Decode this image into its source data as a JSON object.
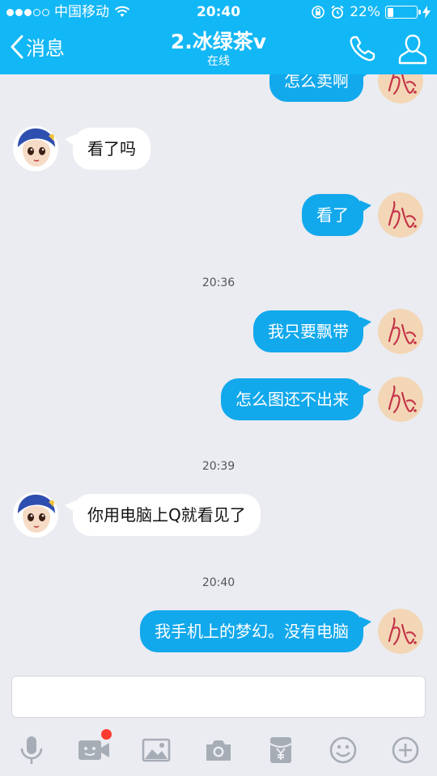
{
  "status_bar": {
    "carrier": "中国移动",
    "time": "20:40",
    "battery_percent": "22%",
    "battery_level": 0.22,
    "signal_filled": 3,
    "signal_total": 5,
    "icons": [
      "wifi-icon",
      "orientation-lock-icon",
      "alarm-icon",
      "charging-icon"
    ]
  },
  "header": {
    "back_label": "消息",
    "title": "2.冰绿茶v",
    "subtitle": "在线",
    "icons": [
      "back-chevron-icon",
      "phone-icon",
      "profile-icon"
    ]
  },
  "messages": [
    {
      "sender": "me",
      "text": "怎么卖啊"
    },
    {
      "sender": "them",
      "text": "看了吗"
    },
    {
      "sender": "me",
      "text": "看了"
    },
    {
      "timestamp": "20:36"
    },
    {
      "sender": "me",
      "text": "我只要飘带"
    },
    {
      "sender": "me",
      "text": "怎么图还不出来"
    },
    {
      "timestamp": "20:39"
    },
    {
      "sender": "them",
      "text": "你用电脑上Q就看见了"
    },
    {
      "timestamp": "20:40"
    },
    {
      "sender": "me",
      "text": "我手机上的梦幻。没有电脑"
    }
  ],
  "input": {
    "value": ""
  },
  "toolbar": {
    "items": [
      "microphone-icon",
      "video-call-icon",
      "image-icon",
      "camera-icon",
      "red-packet-icon",
      "emoji-icon",
      "more-icon"
    ],
    "video_badge": true
  },
  "colors": {
    "accent": "#12b7f5",
    "bubble_me": "#12a8ec",
    "bubble_them": "#ffffff",
    "background": "#eaecf1",
    "toolbar_icon": "#a7adb6",
    "badge": "#ff3b30"
  }
}
